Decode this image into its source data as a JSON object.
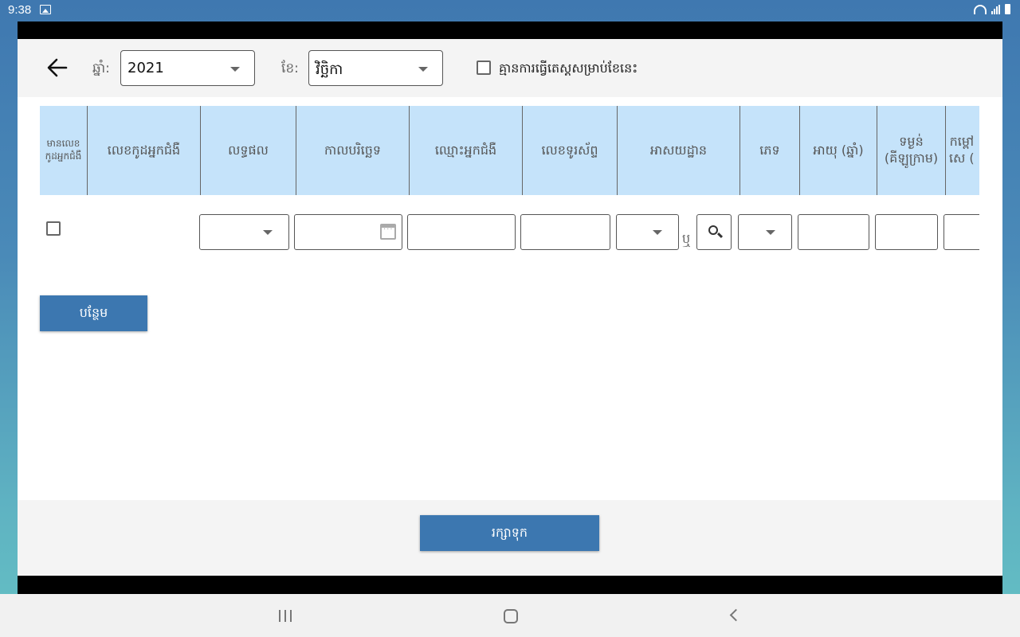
{
  "status_bar": {
    "time": "9:38"
  },
  "header": {
    "year_label": "ឆ្នាំ:",
    "year_value": "2021",
    "month_label": "ខែ:",
    "month_value": "វិច្ឆិកា",
    "no_survey_label": "គ្មានការធ្វើតេស្តសម្រាប់ខែនេះ"
  },
  "table": {
    "columns": [
      "មានលេខ\nកូដអ្នកជំងឺ",
      "លេខកូដអ្នកជំងឺ",
      "លទ្ធផល",
      "កាលបរិច្ឆេទ",
      "ឈ្មោះអ្នកជំងឺ",
      "លេខទូរស័ព្ទ",
      "អាសយដ្ឋាន",
      "ភេទ",
      "អាយុ (ឆ្នាំ)",
      "ទម្ងន់\n(គីឡូក្រាម)",
      "កម្ពៅ\nសេ ("
    ],
    "or_label": "ឬ"
  },
  "buttons": {
    "add_label": "បន្ថែម",
    "save_label": "រក្សាទុក"
  },
  "colors": {
    "accent": "#3c77b0",
    "header_bg": "#c5e3fa"
  }
}
